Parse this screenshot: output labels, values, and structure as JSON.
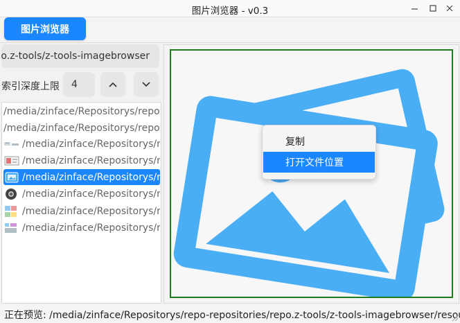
{
  "window": {
    "title": "图片浏览器 - v0.3"
  },
  "toolbar": {
    "tab_label": "图片浏览器"
  },
  "sidebar": {
    "path_value": "o.z-tools/z-tools-imagebrowser",
    "depth_label": "索引深度上限",
    "depth_value": "4",
    "files": [
      {
        "text": "/media/zinface/Repositorys/repo",
        "icon": "none"
      },
      {
        "text": "/media/zinface/Repositorys/repo",
        "icon": "none"
      },
      {
        "text": "/media/zinface/Repositorys/r",
        "icon": "image-thumb-icon"
      },
      {
        "text": "/media/zinface/Repositorys/r",
        "icon": "image-thumb-icon"
      },
      {
        "text": "/media/zinface/Repositorys/r",
        "icon": "image-thumb-icon",
        "selected": true
      },
      {
        "text": "/media/zinface/Repositorys/r",
        "icon": "gear-icon"
      },
      {
        "text": "/media/zinface/Repositorys/r",
        "icon": "image-thumb-icon"
      },
      {
        "text": "/media/zinface/Repositorys/r",
        "icon": "image-thumb-icon"
      }
    ]
  },
  "context_menu": {
    "items": [
      "复制",
      "打开文件位置"
    ],
    "active_index": 1
  },
  "status": {
    "text": "正在预览: /media/zinface/Repositorys/repo-repositories/repo.z-tools/z-tools-imagebrowser/resources/"
  },
  "colors": {
    "accent": "#1a87ff",
    "preview_border": "#1e7a1e",
    "image_blue": "#4aaef5"
  }
}
